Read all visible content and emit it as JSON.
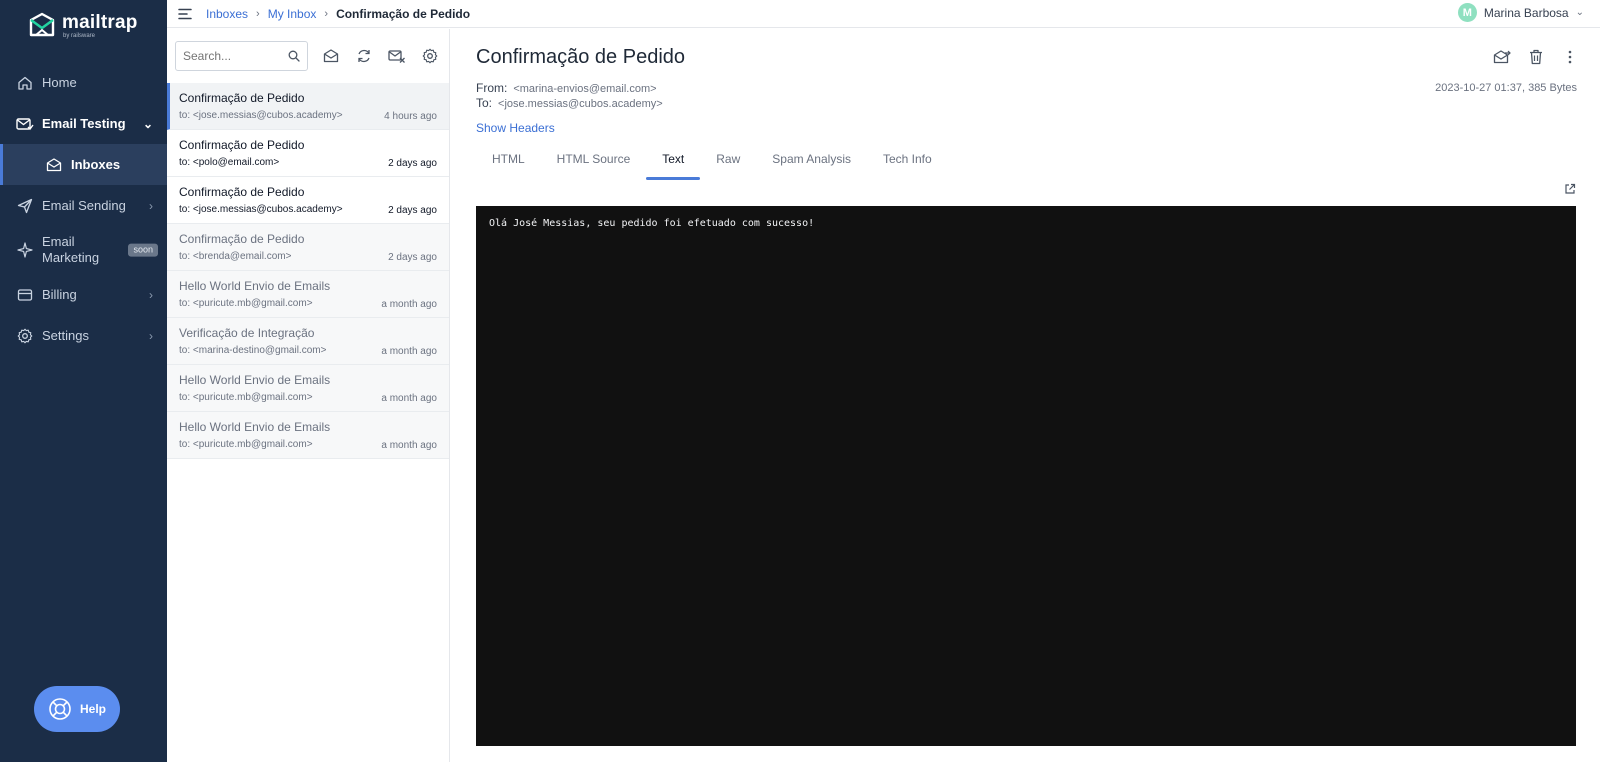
{
  "brand": {
    "name": "mailtrap",
    "sub": "by railsware"
  },
  "sidebar": {
    "items": [
      {
        "label": "Home"
      },
      {
        "label": "Email Testing"
      },
      {
        "label": "Inboxes"
      },
      {
        "label": "Email Sending"
      },
      {
        "label": "Email Marketing",
        "badge": "soon"
      },
      {
        "label": "Billing"
      },
      {
        "label": "Settings"
      }
    ],
    "help_label": "Help"
  },
  "breadcrumb": {
    "items": [
      "Inboxes",
      "My Inbox",
      "Confirmação de Pedido"
    ],
    "separator": "›"
  },
  "user": {
    "initial": "M",
    "name": "Marina Barbosa",
    "avatar_color": "#8fe0c0"
  },
  "list": {
    "search_placeholder": "Search...",
    "messages": [
      {
        "subject": "Confirmação de Pedido",
        "to": "to: <jose.messias@cubos.academy>",
        "time": "4 hours ago",
        "state": "active"
      },
      {
        "subject": "Confirmação de Pedido",
        "to": "to: <polo@email.com>",
        "time": "2 days ago",
        "state": "unread"
      },
      {
        "subject": "Confirmação de Pedido",
        "to": "to: <jose.messias@cubos.academy>",
        "time": "2 days ago",
        "state": "unread"
      },
      {
        "subject": "Confirmação de Pedido",
        "to": "to: <brenda@email.com>",
        "time": "2 days ago",
        "state": "read"
      },
      {
        "subject": "Hello World Envio de Emails",
        "to": "to: <puricute.mb@gmail.com>",
        "time": "a month ago",
        "state": "read"
      },
      {
        "subject": "Verificação de Integração",
        "to": "to: <marina-destino@gmail.com>",
        "time": "a month ago",
        "state": "read"
      },
      {
        "subject": "Hello World Envio de Emails",
        "to": "to: <puricute.mb@gmail.com>",
        "time": "a month ago",
        "state": "read"
      },
      {
        "subject": "Hello World Envio de Emails",
        "to": "to: <puricute.mb@gmail.com>",
        "time": "a month ago",
        "state": "read"
      }
    ]
  },
  "message": {
    "title": "Confirmação de Pedido",
    "from_label": "From:",
    "from": "<marina-envios@email.com>",
    "to_label": "To:",
    "to": "<jose.messias@cubos.academy>",
    "meta": "2023-10-27 01:37, 385 Bytes",
    "show_headers": "Show Headers",
    "tabs": [
      "HTML",
      "HTML Source",
      "Text",
      "Raw",
      "Spam Analysis",
      "Tech Info"
    ],
    "active_tab": "Text",
    "body_text": "Olá José Messias, seu pedido foi efetuado com sucesso!"
  },
  "colors": {
    "sidebar_bg": "#1b2d47",
    "accent": "#4a7bd8",
    "link": "#3b6fd4",
    "help_bg": "#5b8def"
  }
}
